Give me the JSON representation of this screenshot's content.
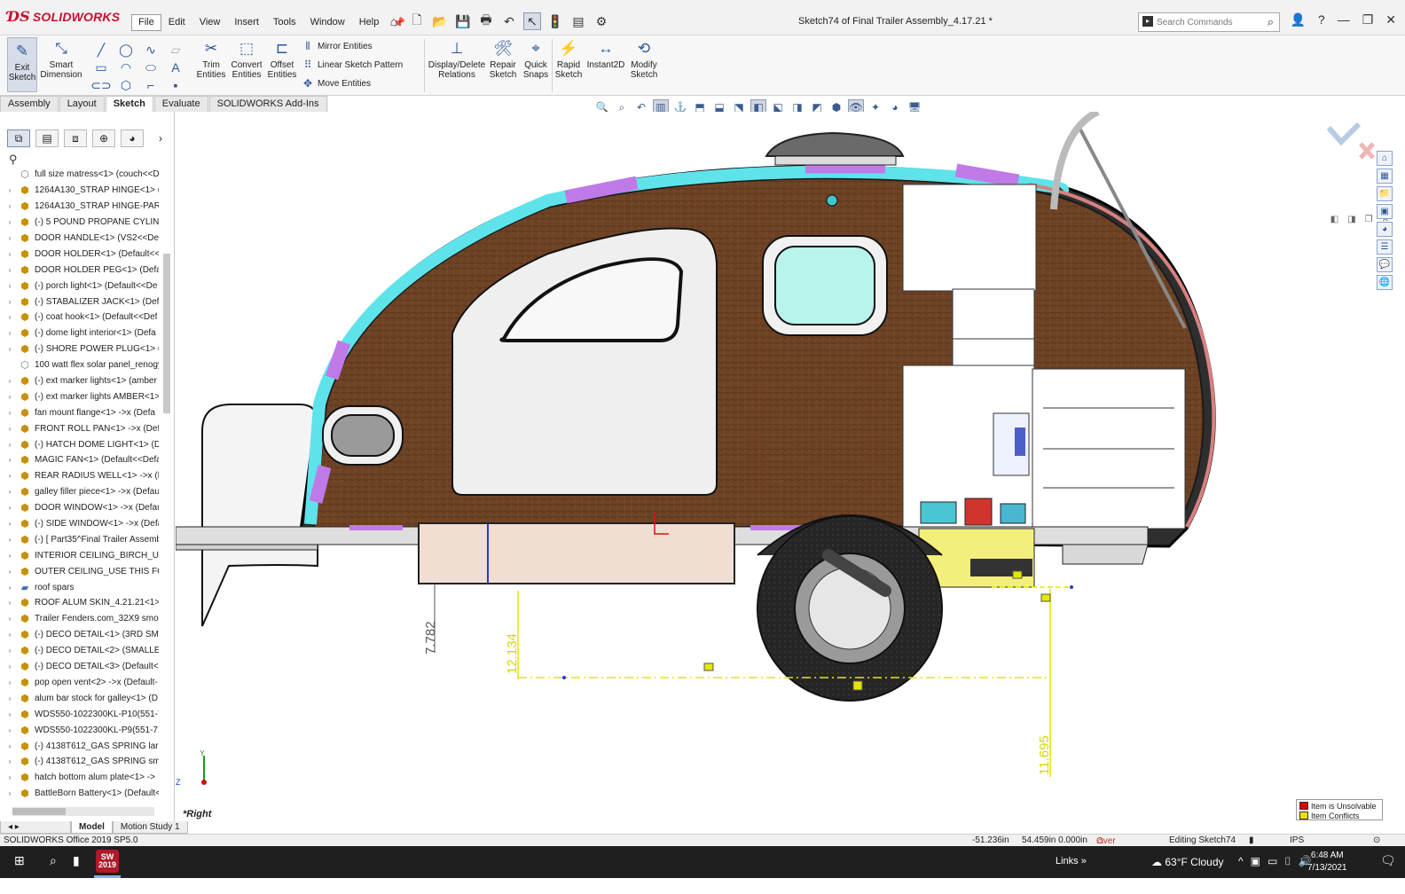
{
  "app": {
    "brand": "SOLIDWORKS",
    "document_title": "Sketch74 of Final Trailer Assembly_4.17.21 *",
    "search_placeholder": "Search Commands"
  },
  "menu": [
    "File",
    "Edit",
    "View",
    "Insert",
    "Tools",
    "Window",
    "Help"
  ],
  "ribbon": {
    "exit_sketch": "Exit Sketch",
    "smart_dimension": "Smart Dimension",
    "trim_entities": "Trim Entities",
    "convert_entities": "Convert Entities",
    "offset_entities": "Offset Entities",
    "mirror_entities": "Mirror Entities",
    "linear_sketch_pattern": "Linear Sketch Pattern",
    "move_entities": "Move Entities",
    "display_delete_relations": "Display/Delete Relations",
    "repair_sketch": "Repair Sketch",
    "quick_snaps": "Quick Snaps",
    "rapid_sketch": "Rapid Sketch",
    "instant2d": "Instant2D",
    "modify_sketch": "Modify Sketch"
  },
  "tabs": [
    "Assembly",
    "Layout",
    "Sketch",
    "Evaluate",
    "SOLIDWORKS Add-Ins"
  ],
  "active_tab": "Sketch",
  "tree": [
    {
      "label": "full size matress<1> (couch<<D",
      "kind": "part"
    },
    {
      "label": "1264A130_STRAP HINGE<1> (12",
      "kind": "assembly"
    },
    {
      "label": "1264A130_STRAP HINGE-PART A",
      "kind": "assembly"
    },
    {
      "label": "(-) 5 POUND PROPANE CYLINDE",
      "kind": "assembly"
    },
    {
      "label": "DOOR HANDLE<1> (VS2<<Defa",
      "kind": "assembly"
    },
    {
      "label": "DOOR HOLDER<1> (Default<<D",
      "kind": "assembly"
    },
    {
      "label": "DOOR HOLDER PEG<1> (Defaul",
      "kind": "assembly"
    },
    {
      "label": "(-) porch light<1> (Default<<De",
      "kind": "assembly"
    },
    {
      "label": "(-) STABALIZER JACK<1> (Defau",
      "kind": "assembly"
    },
    {
      "label": "(-) coat hook<1> (Default<<Def",
      "kind": "assembly"
    },
    {
      "label": "(-) dome light interior<1> (Defa",
      "kind": "assembly"
    },
    {
      "label": "(-) SHORE POWER PLUG<1> (De",
      "kind": "assembly"
    },
    {
      "label": "100 watt flex solar panel_renogy",
      "kind": "part"
    },
    {
      "label": "(-) ext marker lights<1> (amber",
      "kind": "assembly"
    },
    {
      "label": "(-) ext marker lights AMBER<1>",
      "kind": "assembly"
    },
    {
      "label": "fan mount flange<1> ->x (Defa",
      "kind": "assembly"
    },
    {
      "label": "FRONT ROLL PAN<1> ->x (Defa",
      "kind": "assembly"
    },
    {
      "label": "(-) HATCH DOME LIGHT<1> (De",
      "kind": "assembly"
    },
    {
      "label": "MAGIC FAN<1> (Default<<Defa",
      "kind": "assembly"
    },
    {
      "label": "REAR RADIUS WELL<1> ->x (De",
      "kind": "assembly"
    },
    {
      "label": "galley filler piece<1> ->x (Defau",
      "kind": "assembly"
    },
    {
      "label": "DOOR WINDOW<1> ->x (Defau",
      "kind": "assembly"
    },
    {
      "label": "(-) SIDE WINDOW<1> ->x (Defa",
      "kind": "assembly"
    },
    {
      "label": "(-) [ Part35^Final Trailer Assemb",
      "kind": "assembly"
    },
    {
      "label": "INTERIOR CEILING_BIRCH_USE T",
      "kind": "assembly"
    },
    {
      "label": "OUTER CEILING_USE THIS FOR B",
      "kind": "assembly"
    },
    {
      "label": "roof spars",
      "kind": "folder"
    },
    {
      "label": "ROOF ALUM SKIN_4.21.21<1> ->",
      "kind": "assembly"
    },
    {
      "label": "Trailer Fenders.com_32X9 smoot",
      "kind": "assembly"
    },
    {
      "label": "(-) DECO DETAIL<1> (3RD SMAL",
      "kind": "assembly"
    },
    {
      "label": "(-) DECO DETAIL<2> (SMALLER-",
      "kind": "assembly"
    },
    {
      "label": "(-) DECO DETAIL<3> (Default<<",
      "kind": "assembly"
    },
    {
      "label": "pop open vent<2> ->x (Default-",
      "kind": "assembly"
    },
    {
      "label": "alum bar stock for galley<1> (D",
      "kind": "assembly"
    },
    {
      "label": "WDS550-1022300KL-P10(551-72",
      "kind": "assembly"
    },
    {
      "label": "WDS550-1022300KL-P9(551-718)",
      "kind": "assembly"
    },
    {
      "label": "(-) 4138T612_GAS SPRING large",
      "kind": "assembly"
    },
    {
      "label": "(-) 4138T612_GAS SPRING small",
      "kind": "assembly"
    },
    {
      "label": "hatch bottom alum plate<1> ->",
      "kind": "assembly"
    },
    {
      "label": "BattleBorn Battery<1> (Default<",
      "kind": "assembly"
    }
  ],
  "bottom_tabs": [
    "Model",
    "Motion Study 1"
  ],
  "view_label": "*Right",
  "dimensions": {
    "d1": "7.782",
    "d2": "12.134",
    "d3": "11.695"
  },
  "legend": {
    "unsolvable": "Item is Unsolvable",
    "conflicts": "Item Conflicts",
    "unsolvable_color": "#e00000",
    "conflicts_color": "#f0e000"
  },
  "status": {
    "version": "SOLIDWORKS Office 2019 SP5.0",
    "x": "-51.236in",
    "y": "54.459in 0.000in",
    "state": "Over Defined",
    "editing": "Editing Sketch74",
    "units": "IPS"
  },
  "taskbar": {
    "app_badge_top": "SW",
    "app_badge_bottom": "2019",
    "links": "Links",
    "weather": "63°F  Cloudy",
    "time": "6:48 AM",
    "date": "7/13/2021"
  },
  "colors": {
    "accent_brand": "#c8102e",
    "sketch_yellow": "#e8e800",
    "wood": "#6b3f22",
    "cyan_spar": "#5fe3ea",
    "purple_spar": "#c07ae8"
  }
}
